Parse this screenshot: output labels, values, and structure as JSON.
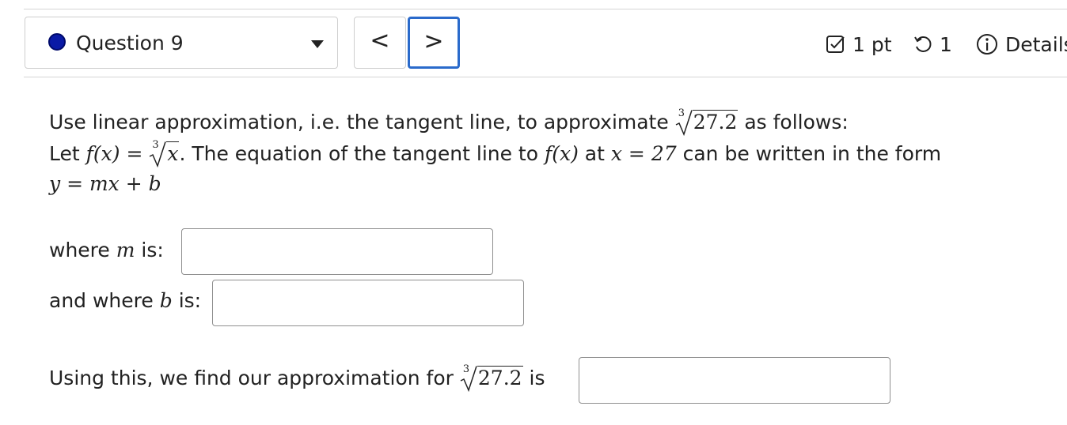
{
  "header": {
    "question_label": "Question 9",
    "prev_label": "<",
    "next_label": ">",
    "points": "1 pt",
    "tries": "1",
    "details": "Details"
  },
  "question": {
    "line1_pre": "Use linear approximation, i.e. the tangent line, to approximate",
    "radicand": "27.2",
    "root_index": "3",
    "line1_post": "as follows:",
    "line2_let": "Let",
    "fx": "f(x)",
    "eq": "=",
    "x": "x",
    "line2_mid": ". The equation of the tangent line to",
    "line2_at": "at",
    "x_eq": "x = 27",
    "line2_post": "can be written in the form",
    "form": "y = mx + b",
    "m_prompt_pre": "where",
    "m_var": "m",
    "m_prompt_post": "is:",
    "b_prompt_pre": "and where",
    "b_var": "b",
    "b_prompt_post": "is:",
    "final_pre": "Using this, we find our approximation for",
    "final_post": "is"
  },
  "inputs": {
    "m_value": "",
    "b_value": "",
    "approx_value": ""
  },
  "colors": {
    "status_dot": "#0a1aa6",
    "focus_border": "#2a6acb"
  }
}
